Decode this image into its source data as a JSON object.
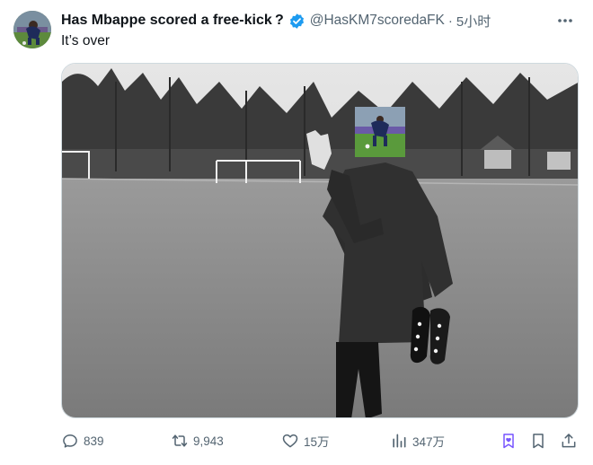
{
  "tweet": {
    "display_name": "Has Mbappe scored a free-kick ?",
    "handle": "@HasKM7scoredaFK",
    "separator": "·",
    "time": "5小时",
    "text": "It’s over"
  },
  "actions": {
    "replies": "839",
    "retweets": "9,943",
    "likes": "15万",
    "views": "347万"
  },
  "colors": {
    "verified": "#1d9bf0",
    "icon_gray": "#536471",
    "bookmark_accent": "#7856ff"
  }
}
